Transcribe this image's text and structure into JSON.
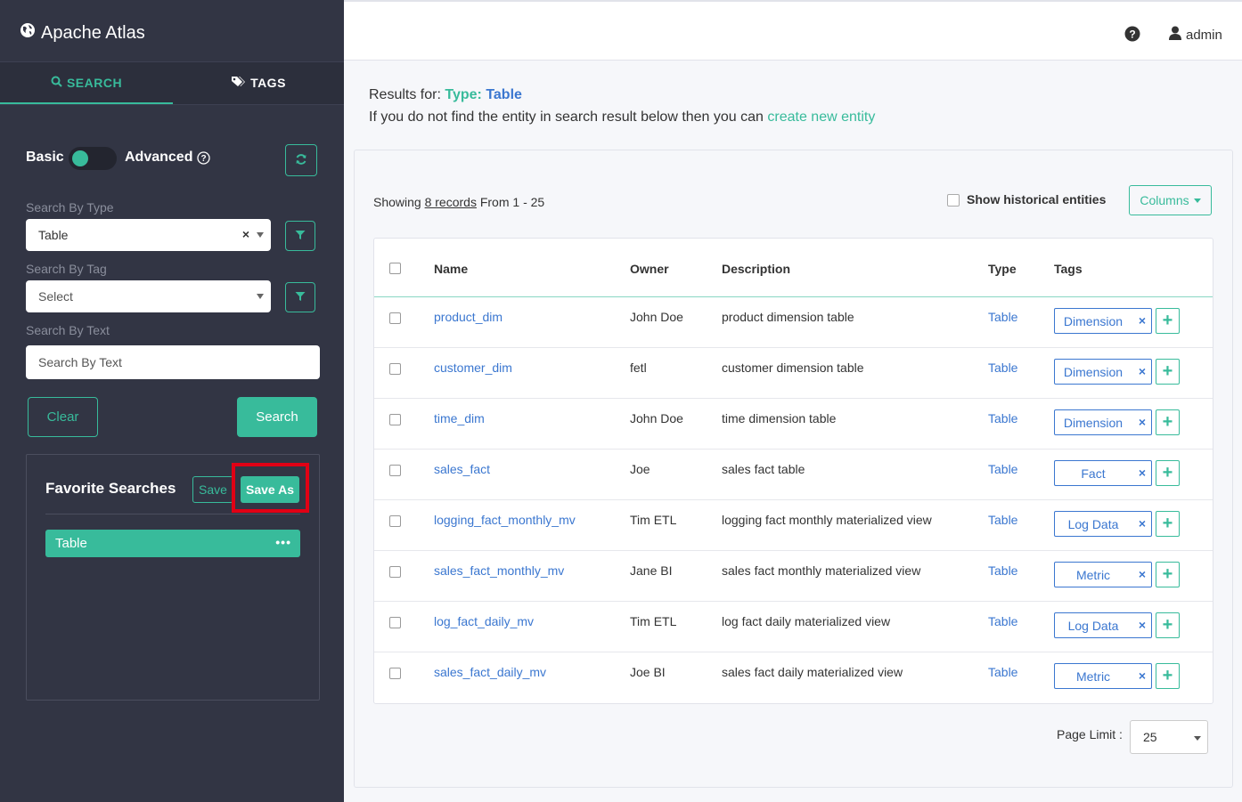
{
  "app": {
    "title": "Apache Atlas"
  },
  "nav": {
    "search_tab": "SEARCH",
    "tags_tab": "TAGS"
  },
  "search_panel": {
    "basic_label": "Basic",
    "advanced_label": "Advanced",
    "search_by_type_label": "Search By Type",
    "type_value": "Table",
    "search_by_tag_label": "Search By Tag",
    "tag_value": "Select",
    "search_by_text_label": "Search By Text",
    "text_placeholder": "Search By Text",
    "clear_label": "Clear",
    "search_label": "Search"
  },
  "favorites": {
    "title": "Favorite Searches",
    "save_label": "Save",
    "save_as_label": "Save As",
    "items": [
      {
        "label": "Table",
        "more": "•••"
      }
    ]
  },
  "header": {
    "user": "admin"
  },
  "results": {
    "prefix": "Results for:",
    "type_label": "Type:",
    "type_value": "Table",
    "info_text": "If you do not find the entity in search result below then you can",
    "create_link": "create new entity",
    "showing_prefix": "Showing",
    "records_link": "8 records",
    "showing_suffix": "From 1 - 25",
    "historical_label": "Show historical entities",
    "columns_label": "Columns"
  },
  "table": {
    "headers": {
      "name": "Name",
      "owner": "Owner",
      "description": "Description",
      "type": "Type",
      "tags": "Tags"
    },
    "rows": [
      {
        "name": "product_dim",
        "owner": "John Doe",
        "description": "product dimension table",
        "type": "Table",
        "tag": "Dimension"
      },
      {
        "name": "customer_dim",
        "owner": "fetl",
        "description": "customer dimension table",
        "type": "Table",
        "tag": "Dimension"
      },
      {
        "name": "time_dim",
        "owner": "John Doe",
        "description": "time dimension table",
        "type": "Table",
        "tag": "Dimension"
      },
      {
        "name": "sales_fact",
        "owner": "Joe",
        "description": "sales fact table",
        "type": "Table",
        "tag": "Fact"
      },
      {
        "name": "logging_fact_monthly_mv",
        "owner": "Tim ETL",
        "description": "logging fact monthly materialized view",
        "type": "Table",
        "tag": "Log Data"
      },
      {
        "name": "sales_fact_monthly_mv",
        "owner": "Jane BI",
        "description": "sales fact monthly materialized view",
        "type": "Table",
        "tag": "Metric"
      },
      {
        "name": "log_fact_daily_mv",
        "owner": "Tim ETL",
        "description": "log fact daily materialized view",
        "type": "Table",
        "tag": "Log Data"
      },
      {
        "name": "sales_fact_daily_mv",
        "owner": "Joe BI",
        "description": "sales fact daily materialized view",
        "type": "Table",
        "tag": "Metric"
      }
    ]
  },
  "pagination": {
    "page_limit_label": "Page Limit :",
    "page_limit_value": "25"
  },
  "colors": {
    "accent": "#38bb9b",
    "link": "#3b77d0",
    "sidebar": "#323544",
    "highlight": "#e10015"
  }
}
